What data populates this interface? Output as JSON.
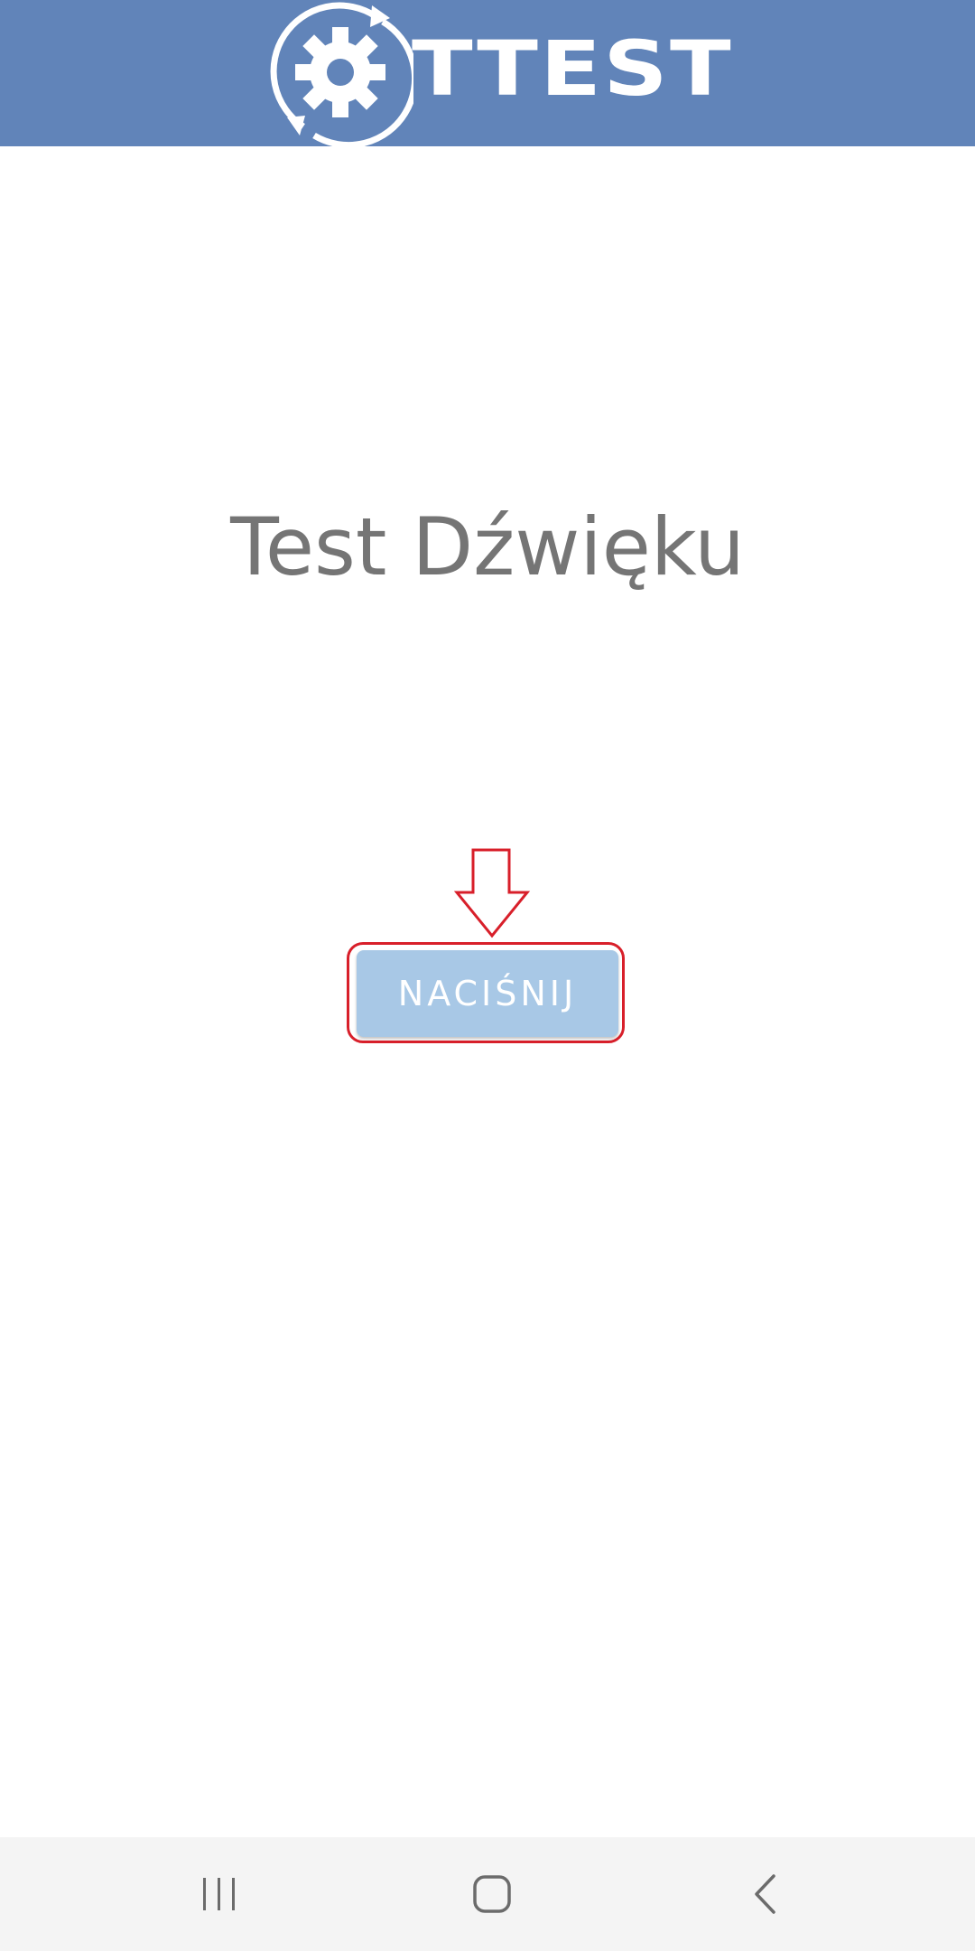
{
  "header": {
    "logo_text": "TTEST",
    "background_color": "#6184b9"
  },
  "main": {
    "title": "Test Dźwięku",
    "button_label": "NACIŚNIJ",
    "button_color": "#a8c8e6",
    "highlight_color": "#d81f2a"
  },
  "nav": {
    "recents_icon": "recents-icon",
    "home_icon": "home-icon",
    "back_icon": "back-icon"
  }
}
